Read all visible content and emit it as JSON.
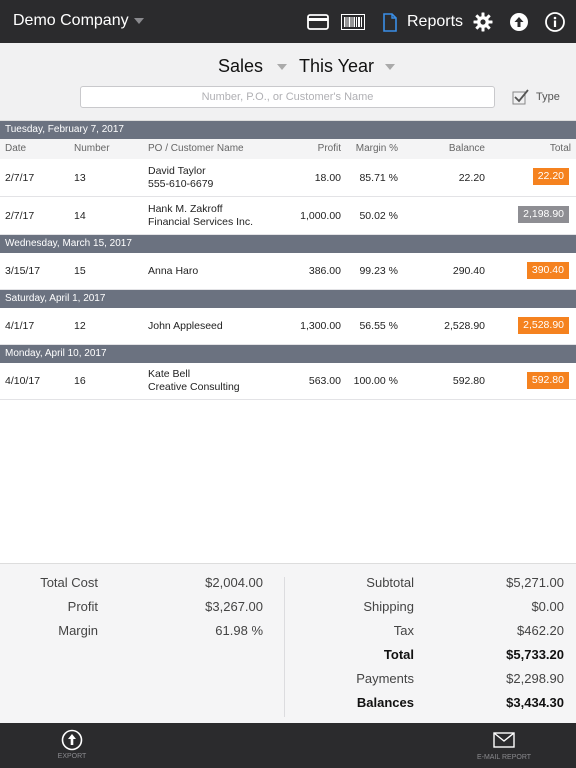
{
  "topbar": {
    "company": "Demo Company",
    "reports_label": "Reports",
    "icons": [
      "card-icon",
      "barcode-icon",
      "document-icon",
      "gear-icon",
      "upload-icon",
      "info-icon"
    ]
  },
  "filter": {
    "sales_label": "Sales",
    "period_label": "This Year",
    "search_placeholder": "Number, P.O., or Customer's Name",
    "type_label": "Type",
    "type_checked": true
  },
  "columns": {
    "date": "Date",
    "number": "Number",
    "po_customer": "PO / Customer Name",
    "profit": "Profit",
    "margin": "Margin %",
    "balance": "Balance",
    "total": "Total"
  },
  "groups": [
    {
      "header": "Tuesday, February 7, 2017",
      "rows": [
        {
          "date": "2/7/17",
          "number": "13",
          "name1": "David Taylor",
          "name2": "555-610-6679",
          "profit": "18.00",
          "margin": "85.71 %",
          "balance": "22.20",
          "total": "22.20",
          "badge": "orange"
        },
        {
          "date": "2/7/17",
          "number": "14",
          "name1": "Hank M. Zakroff",
          "name2": "Financial Services Inc.",
          "profit": "1,000.00",
          "margin": "50.02 %",
          "balance": "",
          "total": "2,198.90",
          "badge": "gray"
        }
      ]
    },
    {
      "header": "Wednesday, March 15, 2017",
      "rows": [
        {
          "date": "3/15/17",
          "number": "15",
          "name1": "Anna Haro",
          "name2": "",
          "profit": "386.00",
          "margin": "99.23 %",
          "balance": "290.40",
          "total": "390.40",
          "badge": "orange"
        }
      ]
    },
    {
      "header": "Saturday, April 1, 2017",
      "rows": [
        {
          "date": "4/1/17",
          "number": "12",
          "name1": "John Appleseed",
          "name2": "",
          "profit": "1,300.00",
          "margin": "56.55 %",
          "balance": "2,528.90",
          "total": "2,528.90",
          "badge": "orange"
        }
      ]
    },
    {
      "header": "Monday, April 10, 2017",
      "rows": [
        {
          "date": "4/10/17",
          "number": "16",
          "name1": "Kate Bell",
          "name2": "Creative Consulting",
          "profit": "563.00",
          "margin": "100.00 %",
          "balance": "592.80",
          "total": "592.80",
          "badge": "orange"
        }
      ]
    }
  ],
  "totals_left": [
    {
      "label": "Total Cost",
      "value": "$2,004.00"
    },
    {
      "label": "Profit",
      "value": "$3,267.00"
    },
    {
      "label": "Margin",
      "value": "61.98 %"
    }
  ],
  "totals_right": [
    {
      "label": "Subtotal",
      "value": "$5,271.00",
      "bold": false
    },
    {
      "label": "Shipping",
      "value": "$0.00",
      "bold": false
    },
    {
      "label": "Tax",
      "value": "$462.20",
      "bold": false
    },
    {
      "label": "Total",
      "value": "$5,733.20",
      "bold": true
    },
    {
      "label": "Payments",
      "value": "$2,298.90",
      "bold": false
    },
    {
      "label": "Balances",
      "value": "$3,434.30",
      "bold": true
    }
  ],
  "bottombar": {
    "export_label": "EXPORT",
    "email_label": "E-MAIL REPORT"
  },
  "colors": {
    "bar": "#2b2b2d",
    "group_header": "#6b7280",
    "badge_orange": "#f5821f",
    "badge_gray": "#8e8e93",
    "accent_blue": "#3a8ee6"
  }
}
